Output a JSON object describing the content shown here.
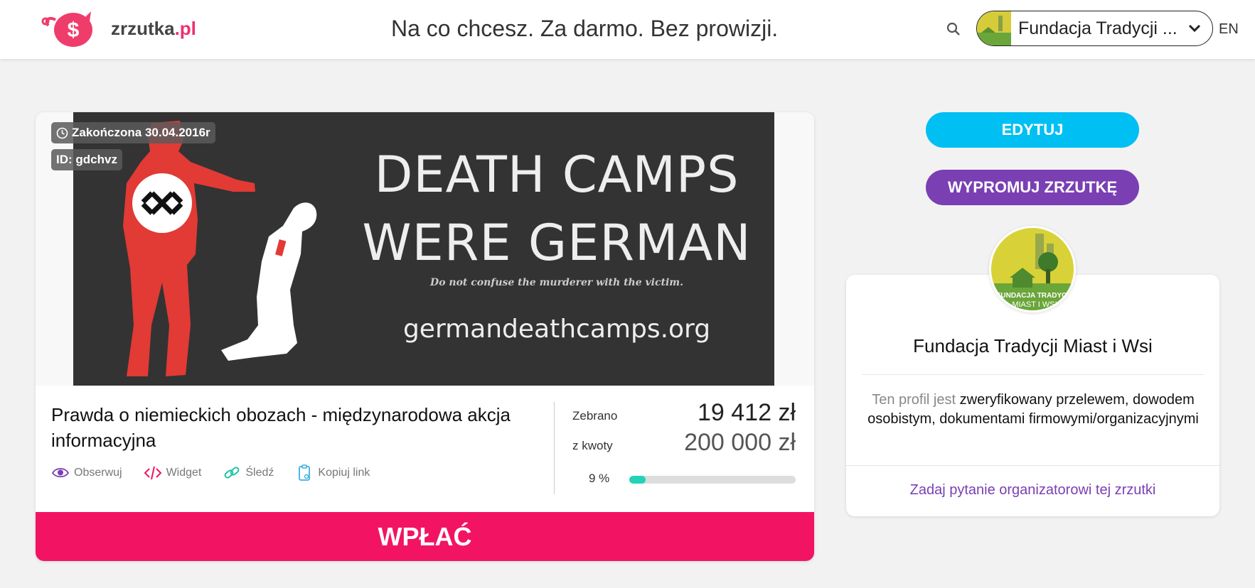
{
  "header": {
    "logo_name": "zrzutka",
    "logo_tld": ".pl",
    "tagline": "Na co chcesz. Za darmo. Bez prowizji.",
    "account_name": "Fundacja Tradycji ...",
    "language": "EN"
  },
  "campaign": {
    "status_badge": "Zakończona 30.04.2016r",
    "id_badge": "ID: gdchvz",
    "banner": {
      "headline_1": "DEATH CAMPS",
      "headline_2": "WERE GERMAN",
      "subline": "Do not confuse the murderer with the victim.",
      "url": "germandeathcamps.org"
    },
    "title": "Prawda o niemieckich obozach - międzynarodowa akcja informacyjna",
    "actions": {
      "watch": "Obserwuj",
      "widget": "Widget",
      "track": "Śledź",
      "copy_link": "Kopiuj link"
    },
    "collected_label": "Zebrano",
    "collected_value": "19 412 zł",
    "goal_label": "z kwoty",
    "goal_value": "200 000 zł",
    "percent_label": "9 %",
    "progress_fraction": 0.097,
    "pay_button": "WPŁAĆ"
  },
  "sidebar": {
    "edit_button": "EDYTUJ",
    "promote_button": "WYPROMUJ ZRZUTKĘ",
    "org_name": "Fundacja Tradycji Miast i Wsi",
    "verify_prefix": "Ten profil jest",
    "verify_text": "zweryfikowany przelewem, dowodem osobistym, dokumentami firmowymi/organizacyjnymi",
    "ask_link": "Zadaj pytanie organizatorowi tej zrzutki",
    "avatar_text_1": "FUNDACJA TRADYCJI",
    "avatar_text_2": "MIAST I WSI"
  },
  "colors": {
    "brand_pink": "#f21462",
    "edit_blue": "#00bff3",
    "promo_purple": "#7a3fb3",
    "progress_teal": "#22d3b6"
  }
}
